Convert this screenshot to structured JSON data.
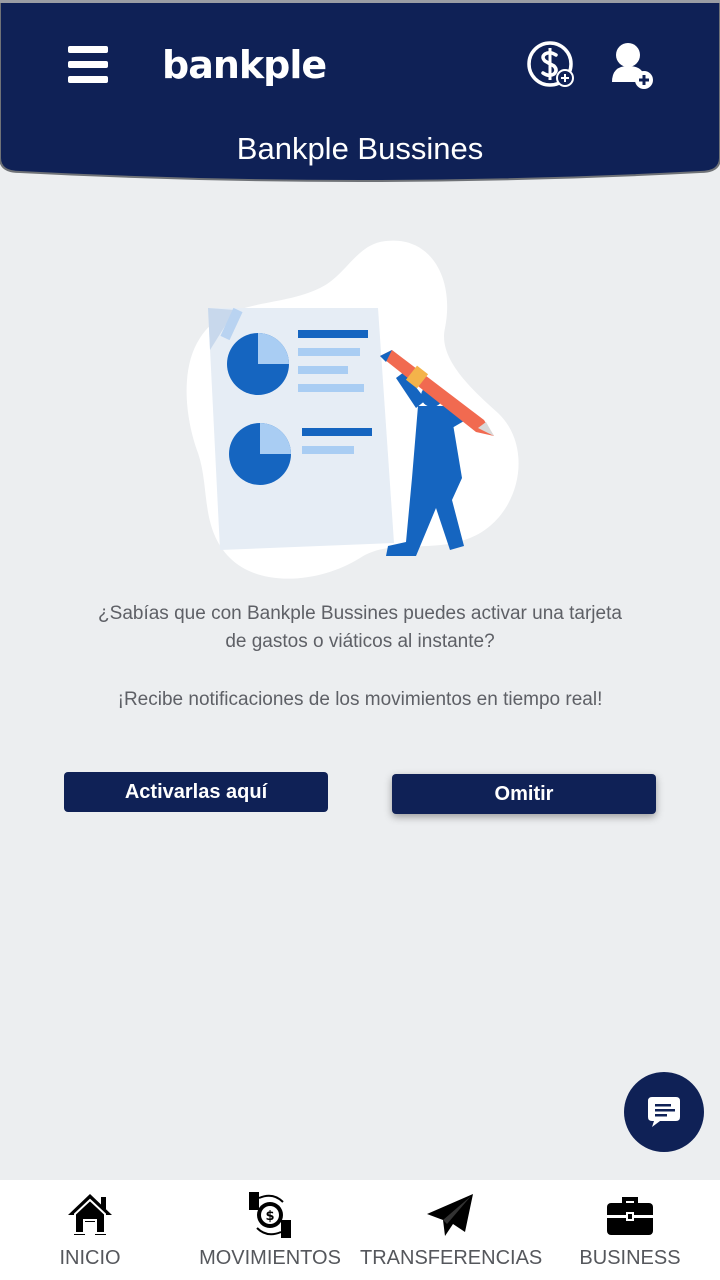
{
  "header": {
    "logo_text": "bankple",
    "title": "Bankple Bussines",
    "bg_color": "#0f2156",
    "icons": [
      "menu-icon",
      "dollar-add-icon",
      "user-add-icon"
    ]
  },
  "promo": {
    "illustration": "business-report-illustration",
    "message_line1": "¿Sabías que con Bankple Bussines puedes activar una tarjeta",
    "message_line2": "de gastos o viáticos al instante?",
    "message_secondary": "¡Recibe notificaciones de los movimientos en tiempo real!"
  },
  "buttons": {
    "activate_label": "Activarlas aquí",
    "skip_label": "Omitir"
  },
  "chat": {
    "icon": "chat-icon"
  },
  "bottom_nav": {
    "items": [
      {
        "label": "INICIO",
        "icon": "home-icon"
      },
      {
        "label": "MOVIMIENTOS",
        "icon": "money-exchange-icon"
      },
      {
        "label": "TRANSFERENCIAS",
        "icon": "paper-plane-icon"
      },
      {
        "label": "BUSINESS",
        "icon": "briefcase-icon"
      }
    ]
  }
}
